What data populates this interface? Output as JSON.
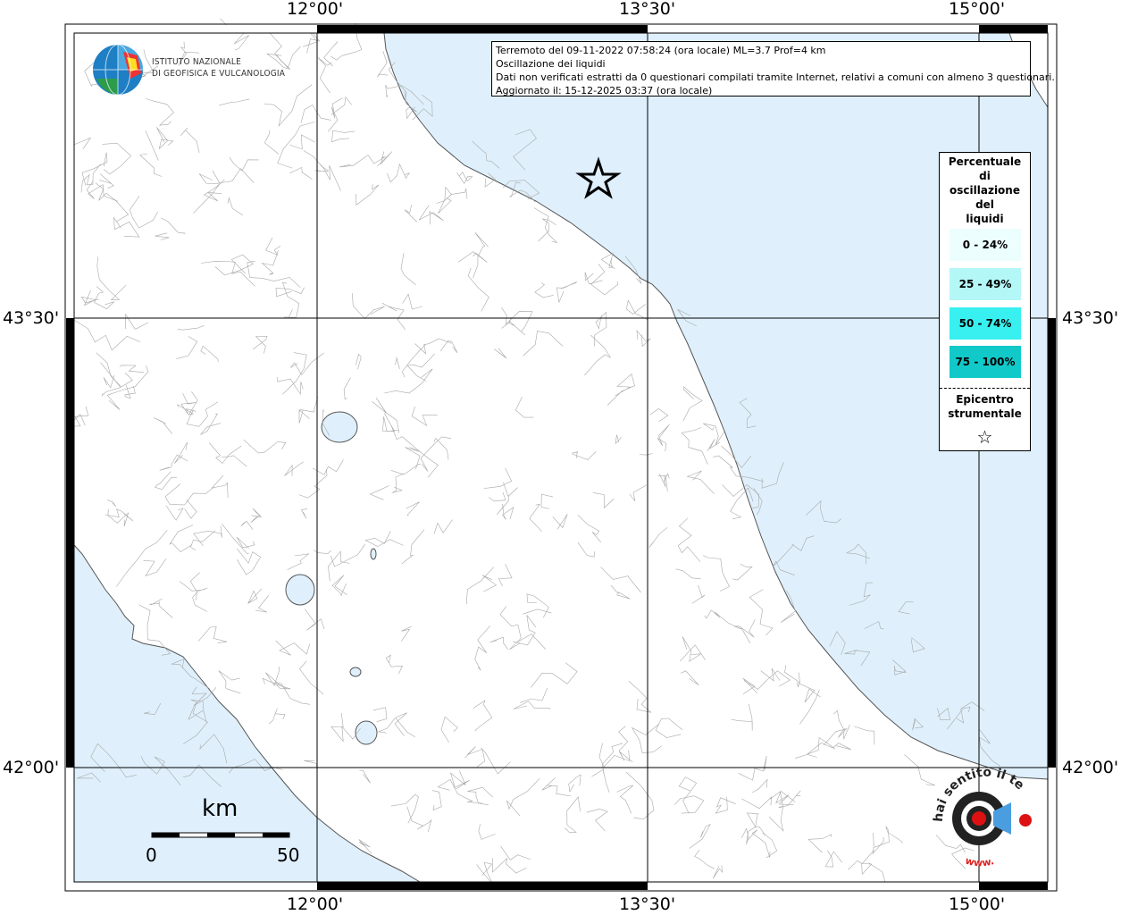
{
  "header": {
    "line1": "Terremoto del 09-11-2022 07:58:24 (ora locale) ML=3.7 Prof=4 km",
    "line2": "Oscillazione dei liquidi",
    "line3": "Dati non verificati estratti da 0 questionari compilati tramite Internet, relativi a comuni con almeno 3 questionari.",
    "line4": "Aggiornato il: 15-12-2025 03:37 (ora locale)"
  },
  "logo": {
    "line1": "ISTITUTO NAZIONALE",
    "line2": "DI GEOFISICA E VULCANOLOGIA"
  },
  "axes": {
    "lon_12": "12°00'",
    "lon_13_30": "13°30'",
    "lon_15": "15°00'",
    "lat_43_30": "43°30'",
    "lat_42": "42°00'"
  },
  "legend": {
    "title": [
      "Percentuale",
      "di",
      "oscillazione",
      "del",
      "liquidi"
    ],
    "classes": [
      {
        "label": "0 - 24%",
        "color": "#ecfefe"
      },
      {
        "label": "25 - 49%",
        "color": "#b4f7f7"
      },
      {
        "label": "50 - 74%",
        "color": "#38f0f0"
      },
      {
        "label": "75 - 100%",
        "color": "#12c9c9"
      }
    ],
    "epicenter_line1": "Epicentro",
    "epicenter_line2": "strumentale"
  },
  "scale": {
    "unit": "km",
    "min": "0",
    "max": "50"
  },
  "badge": {
    "text_top": "hai sentito il terremoto.it",
    "text_bottom": "www."
  },
  "colors": {
    "sea": "#dff0fc",
    "land": "#ffffff",
    "border": "#9a9a9a"
  }
}
